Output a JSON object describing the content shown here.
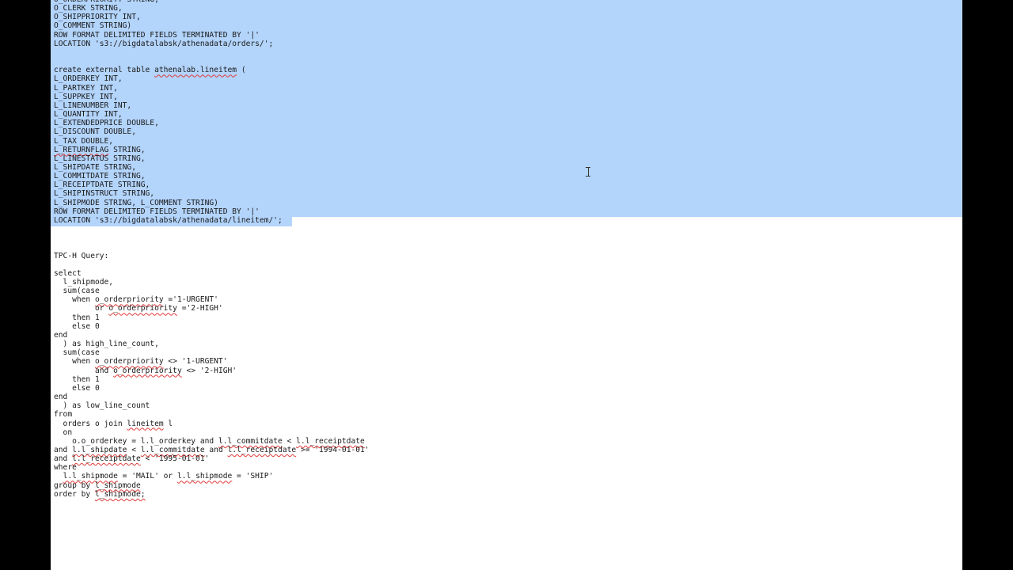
{
  "editor": {
    "lines": [
      [
        "O_ORDERPRIORITY STRING,"
      ],
      [
        "O_CLERK STRING,"
      ],
      [
        "O_SHIPPRIORITY INT,"
      ],
      [
        "O_COMMENT STRING)"
      ],
      [
        "ROW FORMAT DELIMITED FIELDS TERMINATED BY '|'"
      ],
      [
        "LOCATION 's3://bigdatalabsk/athenadata/orders/';"
      ],
      [
        ""
      ],
      [
        ""
      ],
      [
        "create external table ",
        {
          "sq": "athenalab.lineitem"
        },
        " ("
      ],
      [
        "L_ORDERKEY INT,"
      ],
      [
        "L_PARTKEY INT,"
      ],
      [
        "L_SUPPKEY INT,"
      ],
      [
        "L_LINENUMBER INT,"
      ],
      [
        "L_QUANTITY INT,"
      ],
      [
        "L_EXTENDEDPRICE DOUBLE,"
      ],
      [
        "L_DISCOUNT DOUBLE,"
      ],
      [
        "L_TAX DOUBLE,"
      ],
      [
        {
          "sq": "L_RETURNFLAG"
        },
        " STRING,"
      ],
      [
        "L_LINESTATUS STRING,"
      ],
      [
        "L_SHIPDATE STRING,"
      ],
      [
        "L_COMMITDATE STRING,"
      ],
      [
        "L_RECEIPTDATE STRING,"
      ],
      [
        "L_SHIPINSTRUCT STRING,"
      ],
      [
        "L_SHIPMODE STRING, L_COMMENT STRING)"
      ],
      [
        "ROW FORMAT DELIMITED FIELDS TERMINATED BY '|'"
      ],
      [
        "LOCATION 's3://bigdatalabsk/athenadata/lineitem/';"
      ],
      [
        ""
      ],
      [
        ""
      ],
      [
        ""
      ],
      [
        "TPC-H Query:"
      ],
      [
        ""
      ],
      [
        "select"
      ],
      [
        "  l_shipmode,"
      ],
      [
        "  sum(case"
      ],
      [
        "    when ",
        {
          "sq": "o_orderpriority"
        },
        " ='1-URGENT'"
      ],
      [
        "         or ",
        {
          "sq": "o_orderpriority"
        },
        " ='2-HIGH'"
      ],
      [
        "    then 1"
      ],
      [
        "    else 0"
      ],
      [
        "end"
      ],
      [
        "  ) as high_line_count,"
      ],
      [
        "  sum(case"
      ],
      [
        "    when ",
        {
          "sq": "o_orderpriority"
        },
        " <> '1-URGENT'"
      ],
      [
        "         and ",
        {
          "sq": "o_orderpriority"
        },
        " <> '2-HIGH'"
      ],
      [
        "    then 1"
      ],
      [
        "    else 0"
      ],
      [
        "end"
      ],
      [
        "  ) as low_line_count"
      ],
      [
        "from"
      ],
      [
        "  orders o join ",
        {
          "sq": "lineitem"
        },
        " l"
      ],
      [
        "  on"
      ],
      [
        "    o.o_orderkey = l.l_orderkey and ",
        {
          "sq": "l.l_commitdate"
        },
        " < ",
        {
          "sq": "l.l_receiptdate"
        }
      ],
      [
        "and ",
        {
          "sq": "l.l_shipdate"
        },
        " < ",
        {
          "sq": "l.l_commitdate"
        },
        " and ",
        {
          "sq": "l.l_receiptdate"
        },
        " >= '1994-01-01'"
      ],
      [
        "and ",
        {
          "sq": "l.l_receiptdate"
        },
        " < '1995-01-01'"
      ],
      [
        "where"
      ],
      [
        "  ",
        {
          "sq": "l.l_shipmode"
        },
        " = 'MAIL' or ",
        {
          "sq": "l.l_shipmode"
        },
        " = 'SHIP'"
      ],
      [
        "group by ",
        {
          "sq": "l_shipmode"
        }
      ],
      [
        "order by ",
        {
          "sq": "l_shipmode;"
        }
      ]
    ]
  },
  "colors": {
    "selection": "#b3d4fb",
    "page": "#ffffff",
    "desktop": "#000000",
    "text": "#1a1a1a",
    "spellcheck": "#e23a3a"
  },
  "cursor_icon": "i-beam-cursor-icon"
}
